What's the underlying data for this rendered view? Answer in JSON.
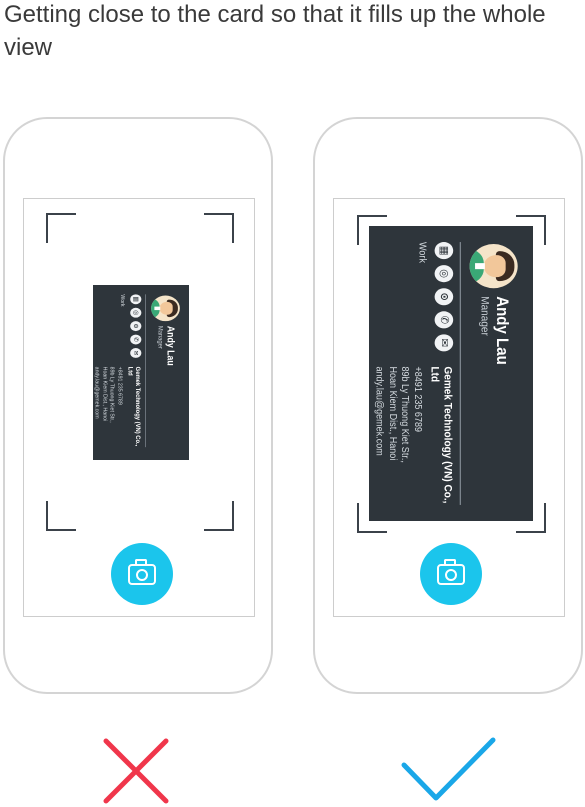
{
  "instruction": "Getting close to the card so that it fills up the whole view",
  "card": {
    "name": "Andy Lau",
    "role": "Manager",
    "company": "Gemek Technology (VN) Co., Ltd",
    "phone": "+8491 235 6789",
    "address_line1": "89b Ly Thuong Kiet Str.,",
    "address_line2": "Hoan Kiem Dist., Hanoi",
    "email": "andy.lau@gemek.com",
    "label": "Work"
  },
  "examples": [
    {
      "result": "incorrect",
      "result_icon": "cross-icon",
      "color": "#f0364b"
    },
    {
      "result": "correct",
      "result_icon": "check-icon",
      "color": "#1aa7e8"
    }
  ],
  "colors": {
    "accent": "#1bc5ec",
    "card": "#2e353b"
  }
}
